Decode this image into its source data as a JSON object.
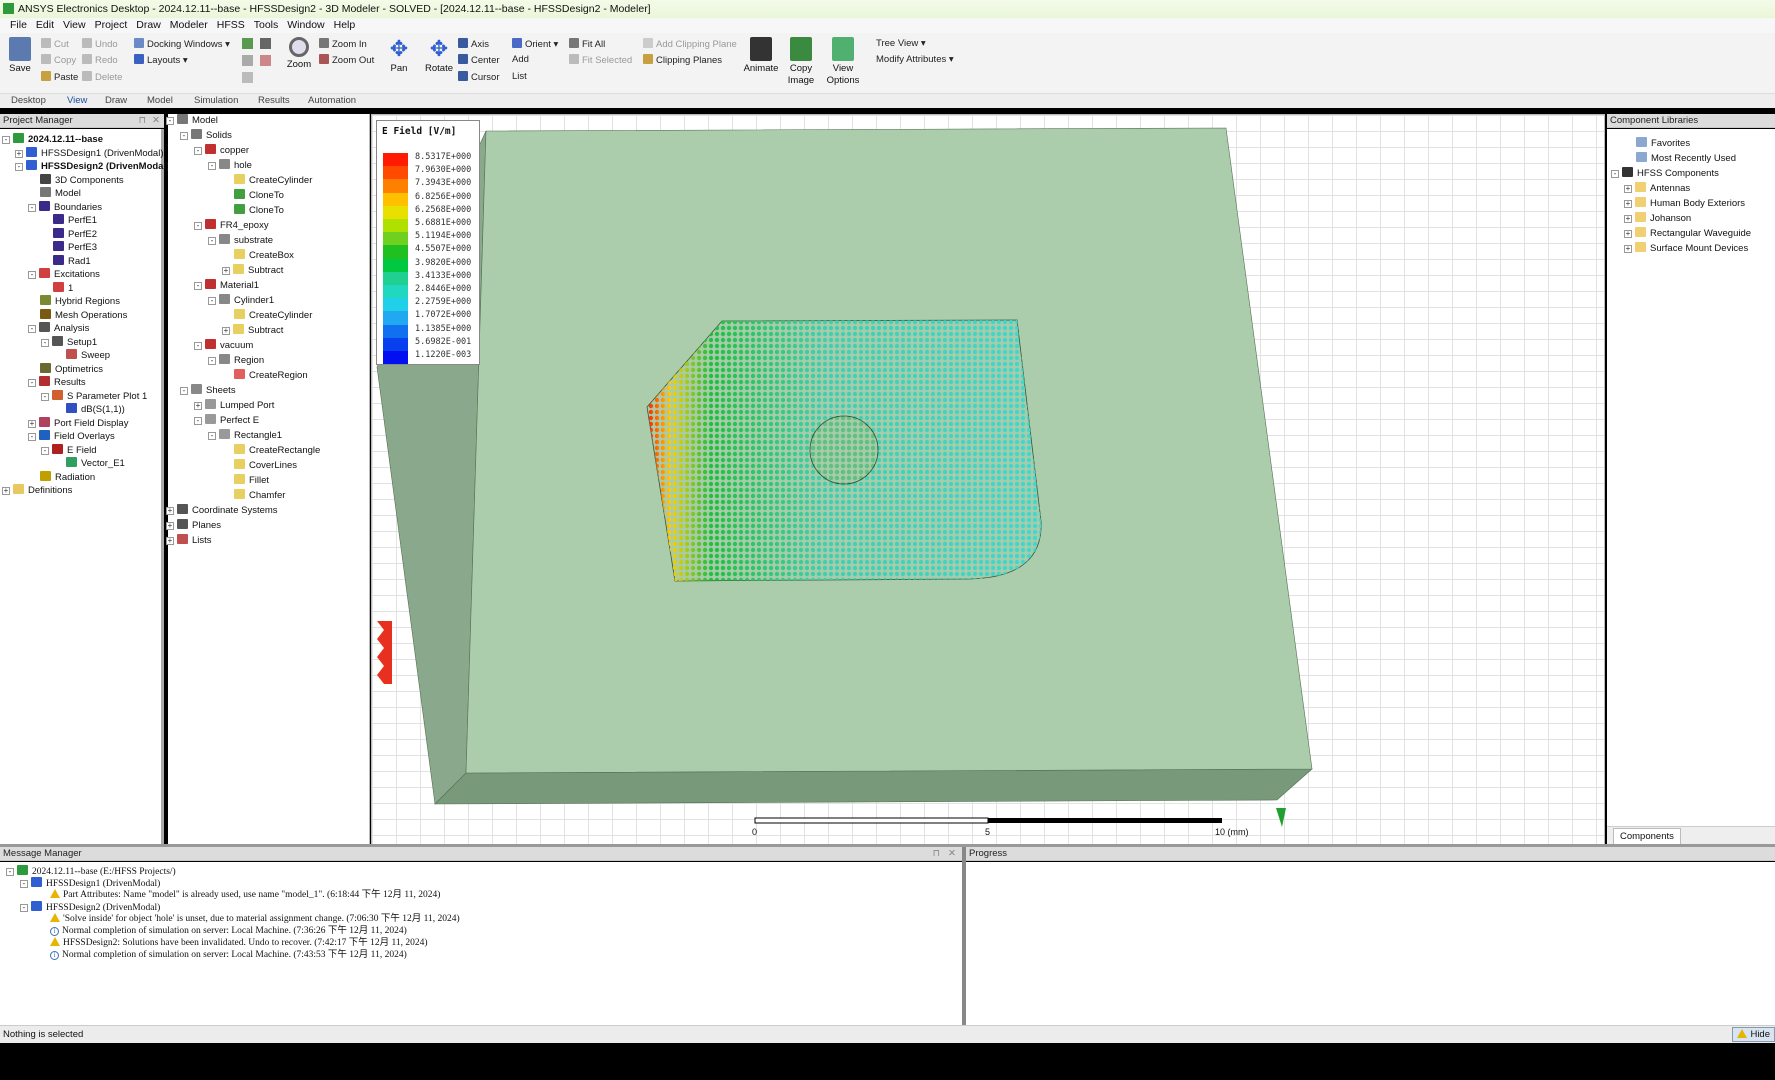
{
  "window": {
    "title": "ANSYS Electronics Desktop - 2024.12.11--base - HFSSDesign2 - 3D Modeler - SOLVED - [2024.12.11--base - HFSSDesign2 - Modeler]"
  },
  "menu": [
    "File",
    "Edit",
    "View",
    "Project",
    "Draw",
    "Modeler",
    "HFSS",
    "Tools",
    "Window",
    "Help"
  ],
  "ribbon": {
    "save": "Save",
    "cut": "Cut",
    "copy": "Copy",
    "paste": "Paste",
    "undo": "Undo",
    "redo": "Redo",
    "delete": "Delete",
    "docking": "Docking Windows ▾",
    "layouts": "Layouts ▾",
    "zoom": "Zoom",
    "zoom_in": "Zoom In",
    "zoom_out": "Zoom Out",
    "pan": "Pan",
    "rotate": "Rotate",
    "axis": "Axis",
    "center": "Center",
    "cursor": "Cursor",
    "orient": "Orient ▾",
    "add": "Add",
    "list": "List",
    "fit_all": "Fit All",
    "fit_selected": "Fit Selected",
    "add_clip": "Add Clipping Plane",
    "clip_planes": "Clipping Planes",
    "animate": "Animate",
    "copy_image_1": "Copy",
    "copy_image_2": "Image",
    "view_options_1": "View",
    "view_options_2": "Options",
    "tree_view": "Tree View ▾",
    "modify_attr": "Modify Attributes ▾"
  },
  "tabs": [
    {
      "label": "Desktop"
    },
    {
      "label": "View",
      "active": true
    },
    {
      "label": "Draw"
    },
    {
      "label": "Model"
    },
    {
      "label": "Simulation"
    },
    {
      "label": "Results"
    },
    {
      "label": "Automation"
    }
  ],
  "project_manager": {
    "title": "Project Manager",
    "items": [
      {
        "label": "2024.12.11--base",
        "depth": 0,
        "tog": "-",
        "bold": true,
        "icon": "#2e9a3e"
      },
      {
        "label": "HFSSDesign1 (DrivenModal)",
        "depth": 1,
        "tog": "+",
        "icon": "#2f5fd0"
      },
      {
        "label": "HFSSDesign2 (DrivenModal)",
        "depth": 1,
        "tog": "-",
        "bold": true,
        "icon": "#2f5fd0"
      },
      {
        "label": "3D Components",
        "depth": 2,
        "icon": "#444"
      },
      {
        "label": "Model",
        "depth": 2,
        "icon": "#777"
      },
      {
        "label": "Boundaries",
        "depth": 2,
        "tog": "-",
        "icon": "#3b2a8a"
      },
      {
        "label": "PerfE1",
        "depth": 3,
        "icon": "#3b2a8a"
      },
      {
        "label": "PerfE2",
        "depth": 3,
        "icon": "#3b2a8a"
      },
      {
        "label": "PerfE3",
        "depth": 3,
        "icon": "#3b2a8a"
      },
      {
        "label": "Rad1",
        "depth": 3,
        "icon": "#3b2a8a"
      },
      {
        "label": "Excitations",
        "depth": 2,
        "tog": "-",
        "icon": "#d04040"
      },
      {
        "label": "1",
        "depth": 3,
        "icon": "#d04040"
      },
      {
        "label": "Hybrid Regions",
        "depth": 2,
        "icon": "#7a8a30"
      },
      {
        "label": "Mesh Operations",
        "depth": 2,
        "icon": "#7a5a10"
      },
      {
        "label": "Analysis",
        "depth": 2,
        "tog": "-",
        "icon": "#555"
      },
      {
        "label": "Setup1",
        "depth": 3,
        "tog": "-",
        "icon": "#555"
      },
      {
        "label": "Sweep",
        "depth": 4,
        "icon": "#c05050"
      },
      {
        "label": "Optimetrics",
        "depth": 2,
        "icon": "#6a6a30"
      },
      {
        "label": "Results",
        "depth": 2,
        "tog": "-",
        "icon": "#b03030"
      },
      {
        "label": "S Parameter Plot 1",
        "depth": 3,
        "tog": "-",
        "icon": "#d06030"
      },
      {
        "label": "dB(S(1,1))",
        "depth": 4,
        "icon": "#3050c0"
      },
      {
        "label": "Port Field Display",
        "depth": 2,
        "tog": "+",
        "icon": "#b04060"
      },
      {
        "label": "Field Overlays",
        "depth": 2,
        "tog": "-",
        "icon": "#2060c0"
      },
      {
        "label": "E Field",
        "depth": 3,
        "tog": "-",
        "icon": "#b02020"
      },
      {
        "label": "Vector_E1",
        "depth": 4,
        "icon": "#30a060"
      },
      {
        "label": "Radiation",
        "depth": 2,
        "icon": "#c0a000"
      },
      {
        "label": "Definitions",
        "depth": 0,
        "tog": "+",
        "icon": "#e8c860"
      }
    ]
  },
  "model_tree": {
    "items": [
      {
        "label": "Model",
        "depth": 0,
        "tog": "-",
        "icon": "#777"
      },
      {
        "label": "Solids",
        "depth": 1,
        "tog": "-",
        "icon": "#777"
      },
      {
        "label": "copper",
        "depth": 2,
        "tog": "-",
        "icon": "#c03030"
      },
      {
        "label": "hole",
        "depth": 3,
        "tog": "-",
        "icon": "#888"
      },
      {
        "label": "CreateCylinder",
        "depth": 4,
        "icon": "#e8d060"
      },
      {
        "label": "CloneTo",
        "depth": 4,
        "icon": "#40a040"
      },
      {
        "label": "CloneTo",
        "depth": 4,
        "icon": "#40a040"
      },
      {
        "label": "FR4_epoxy",
        "depth": 2,
        "tog": "-",
        "icon": "#c03030"
      },
      {
        "label": "substrate",
        "depth": 3,
        "tog": "-",
        "icon": "#888"
      },
      {
        "label": "CreateBox",
        "depth": 4,
        "icon": "#e8d060"
      },
      {
        "label": "Subtract",
        "depth": 4,
        "tog": "+",
        "icon": "#e8d060"
      },
      {
        "label": "Material1",
        "depth": 2,
        "tog": "-",
        "icon": "#c03030"
      },
      {
        "label": "Cylinder1",
        "depth": 3,
        "tog": "-",
        "icon": "#888"
      },
      {
        "label": "CreateCylinder",
        "depth": 4,
        "icon": "#e8d060"
      },
      {
        "label": "Subtract",
        "depth": 4,
        "tog": "+",
        "icon": "#e8d060"
      },
      {
        "label": "vacuum",
        "depth": 2,
        "tog": "-",
        "icon": "#c03030"
      },
      {
        "label": "Region",
        "depth": 3,
        "tog": "-",
        "icon": "#888"
      },
      {
        "label": "CreateRegion",
        "depth": 4,
        "icon": "#e06060"
      },
      {
        "label": "Sheets",
        "depth": 1,
        "tog": "-",
        "icon": "#888"
      },
      {
        "label": "Lumped Port",
        "depth": 2,
        "tog": "+",
        "icon": "#999"
      },
      {
        "label": "Perfect E",
        "depth": 2,
        "tog": "-",
        "icon": "#999"
      },
      {
        "label": "Rectangle1",
        "depth": 3,
        "tog": "-",
        "icon": "#999"
      },
      {
        "label": "CreateRectangle",
        "depth": 4,
        "icon": "#e8d060"
      },
      {
        "label": "CoverLines",
        "depth": 4,
        "icon": "#e8d060"
      },
      {
        "label": "Fillet",
        "depth": 4,
        "icon": "#e8d060"
      },
      {
        "label": "Chamfer",
        "depth": 4,
        "icon": "#e8d060"
      },
      {
        "label": "Coordinate Systems",
        "depth": 0,
        "tog": "+",
        "icon": "#555"
      },
      {
        "label": "Planes",
        "depth": 0,
        "tog": "+",
        "icon": "#555"
      },
      {
        "label": "Lists",
        "depth": 0,
        "tog": "+",
        "icon": "#c05050"
      }
    ]
  },
  "legend": {
    "title": "E Field [V/m]",
    "values": [
      "8.5317E+000",
      "7.9630E+000",
      "7.3943E+000",
      "6.8256E+000",
      "6.2568E+000",
      "5.6881E+000",
      "5.1194E+000",
      "4.5507E+000",
      "3.9820E+000",
      "3.4133E+000",
      "2.8446E+000",
      "2.2759E+000",
      "1.7072E+000",
      "1.1385E+000",
      "5.6982E-001",
      "1.1220E-003"
    ],
    "colors": [
      "#ff1a00",
      "#ff4a00",
      "#ff8000",
      "#ffc000",
      "#e8e000",
      "#b0e000",
      "#70d020",
      "#20c020",
      "#00c840",
      "#20d090",
      "#20d8c0",
      "#20d0e8",
      "#20a8f0",
      "#1070f0",
      "#0840f0",
      "#0010f0"
    ]
  },
  "scale_bar": {
    "labels": [
      "0",
      "5",
      "10 (mm)"
    ]
  },
  "component_libraries": {
    "title": "Component Libraries",
    "items": [
      {
        "label": "Favorites",
        "depth": 1,
        "icon": "#8aa8d0"
      },
      {
        "label": "Most Recently Used",
        "depth": 1,
        "icon": "#8aa8d0"
      },
      {
        "label": "HFSS Components",
        "depth": 0,
        "tog": "-",
        "icon": "#333"
      },
      {
        "label": "Antennas",
        "depth": 1,
        "tog": "+",
        "icon": "#f0d070"
      },
      {
        "label": "Human Body Exteriors",
        "depth": 1,
        "tog": "+",
        "icon": "#f0d070"
      },
      {
        "label": "Johanson",
        "depth": 1,
        "tog": "+",
        "icon": "#f0d070"
      },
      {
        "label": "Rectangular Waveguide",
        "depth": 1,
        "tog": "+",
        "icon": "#f0d070"
      },
      {
        "label": "Surface Mount Devices",
        "depth": 1,
        "tog": "+",
        "icon": "#f0d070"
      }
    ],
    "tab": "Components"
  },
  "message_manager": {
    "title": "Message Manager",
    "items": [
      {
        "text": "2024.12.11--base (E:/HFSS Projects/)",
        "depth": 0,
        "type": "project"
      },
      {
        "text": "HFSSDesign1 (DrivenModal)",
        "depth": 1,
        "type": "design"
      },
      {
        "text": "Part Attributes: Name \"model\" is already used, use name \"model_1\". (6:18:44 下午  12月 11, 2024)",
        "depth": 2,
        "type": "warning"
      },
      {
        "text": "HFSSDesign2 (DrivenModal)",
        "depth": 1,
        "type": "design"
      },
      {
        "text": "'Solve inside' for object 'hole' is unset, due to material assignment change. (7:06:30 下午  12月 11, 2024)",
        "depth": 2,
        "type": "warning"
      },
      {
        "text": "Normal completion of simulation on server: Local Machine. (7:36:26 下午  12月 11, 2024)",
        "depth": 2,
        "type": "info"
      },
      {
        "text": "HFSSDesign2: Solutions have been invalidated. Undo to recover. (7:42:17 下午  12月 11, 2024)",
        "depth": 2,
        "type": "warning"
      },
      {
        "text": "Normal completion of simulation on server: Local Machine. (7:43:53 下午  12月 11, 2024)",
        "depth": 2,
        "type": "info"
      }
    ]
  },
  "progress": {
    "title": "Progress"
  },
  "status": {
    "text": "Nothing is selected",
    "hide": "Hide"
  }
}
